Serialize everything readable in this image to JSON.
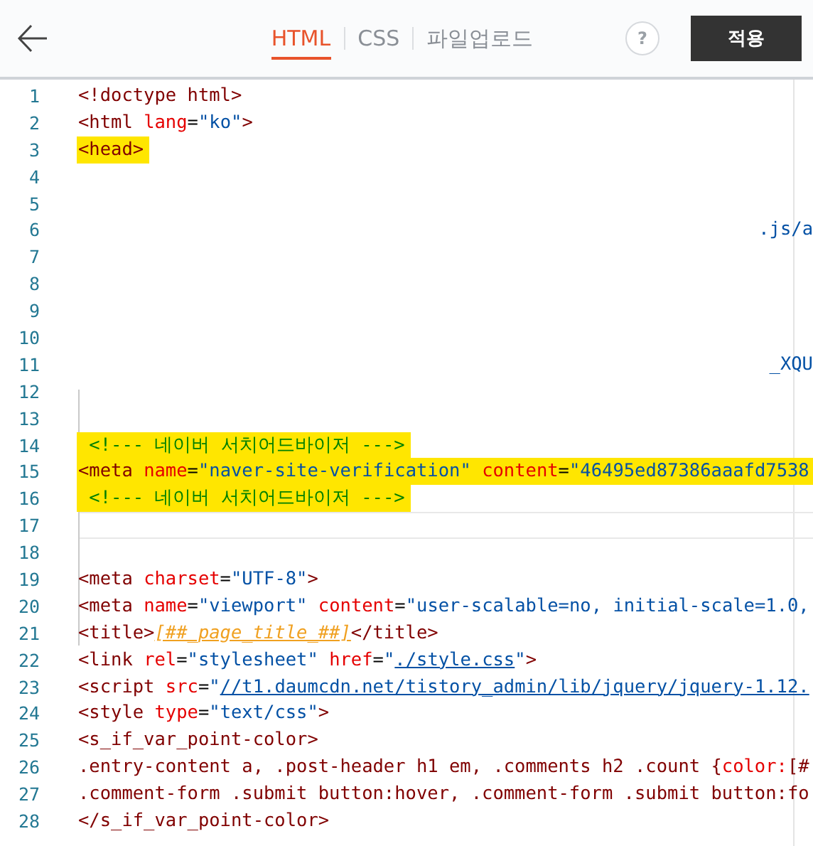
{
  "header": {
    "tabs": [
      {
        "label": "HTML",
        "selected": true
      },
      {
        "label": "CSS",
        "selected": false
      },
      {
        "label": "파일업로드",
        "selected": false
      }
    ],
    "help_button": "?",
    "apply_button": "적용"
  },
  "editor": {
    "lines": [
      {
        "number": "1",
        "highlighted": false,
        "current": false,
        "tokens": [
          {
            "kind": "tag",
            "text": "<!doctype html>"
          }
        ]
      },
      {
        "number": "2",
        "highlighted": false,
        "current": false,
        "tokens": [
          {
            "kind": "tag",
            "text": "<html "
          },
          {
            "kind": "attr",
            "text": "lang"
          },
          {
            "kind": "text",
            "text": "="
          },
          {
            "kind": "string",
            "text": "\"ko\""
          },
          {
            "kind": "tag",
            "text": ">"
          }
        ]
      },
      {
        "number": "3",
        "highlighted": true,
        "current": false,
        "tokens": [
          {
            "kind": "tag",
            "text": "<head>"
          }
        ]
      },
      {
        "number": "4",
        "highlighted": false,
        "current": false
      },
      {
        "number": "5",
        "highlighted": false,
        "current": false
      },
      {
        "number": "6",
        "highlighted": false,
        "current": false,
        "tokens": [
          {
            "kind": "tail",
            "text": ".js/a"
          }
        ]
      },
      {
        "number": "7",
        "highlighted": false,
        "current": false
      },
      {
        "number": "8",
        "highlighted": false,
        "current": false
      },
      {
        "number": "9",
        "highlighted": false,
        "current": false
      },
      {
        "number": "10",
        "highlighted": false,
        "current": false
      },
      {
        "number": "11",
        "highlighted": false,
        "current": false,
        "tokens": [
          {
            "kind": "tail",
            "text": "_XQU"
          }
        ]
      },
      {
        "number": "12",
        "highlighted": false,
        "current": false
      },
      {
        "number": "13",
        "highlighted": false,
        "current": false
      },
      {
        "number": "14",
        "highlighted": true,
        "current": false,
        "tokens": [
          {
            "kind": "comment",
            "text": " <!--- 네이버 서치어드바이저 --->"
          }
        ]
      },
      {
        "number": "15",
        "highlighted": true,
        "current": false,
        "tokens": [
          {
            "kind": "tag",
            "text": "<meta "
          },
          {
            "kind": "attr",
            "text": "name"
          },
          {
            "kind": "text",
            "text": "="
          },
          {
            "kind": "string",
            "text": "\"naver-site-verification\" "
          },
          {
            "kind": "attr",
            "text": "content"
          },
          {
            "kind": "text",
            "text": "="
          },
          {
            "kind": "string",
            "text": "\"46495ed87386aaafd7538"
          }
        ]
      },
      {
        "number": "16",
        "highlighted": true,
        "current": false,
        "tokens": [
          {
            "kind": "comment",
            "text": " <!--- 네이버 서치어드바이저 --->"
          }
        ]
      },
      {
        "number": "17",
        "highlighted": false,
        "current": true
      },
      {
        "number": "18",
        "highlighted": false,
        "current": false
      },
      {
        "number": "19",
        "highlighted": false,
        "current": false,
        "tokens": [
          {
            "kind": "tag",
            "text": "<meta "
          },
          {
            "kind": "attr",
            "text": "charset"
          },
          {
            "kind": "text",
            "text": "="
          },
          {
            "kind": "string",
            "text": "\"UTF-8\""
          },
          {
            "kind": "tag",
            "text": ">"
          }
        ]
      },
      {
        "number": "20",
        "highlighted": false,
        "current": false,
        "tokens": [
          {
            "kind": "tag",
            "text": "<meta "
          },
          {
            "kind": "attr",
            "text": "name"
          },
          {
            "kind": "text",
            "text": "="
          },
          {
            "kind": "string",
            "text": "\"viewport\" "
          },
          {
            "kind": "attr",
            "text": "content"
          },
          {
            "kind": "text",
            "text": "="
          },
          {
            "kind": "string",
            "text": "\"user-scalable=no, initial-scale=1.0,"
          }
        ]
      },
      {
        "number": "21",
        "highlighted": false,
        "current": false,
        "tokens": [
          {
            "kind": "tag",
            "text": "<title>"
          },
          {
            "kind": "template",
            "text": "[##_page_title_##]"
          },
          {
            "kind": "tag",
            "text": "</title>"
          }
        ]
      },
      {
        "number": "22",
        "highlighted": false,
        "current": false,
        "tokens": [
          {
            "kind": "tag",
            "text": "<link "
          },
          {
            "kind": "attr",
            "text": "rel"
          },
          {
            "kind": "text",
            "text": "="
          },
          {
            "kind": "string",
            "text": "\"stylesheet\" "
          },
          {
            "kind": "attr",
            "text": "href"
          },
          {
            "kind": "text",
            "text": "="
          },
          {
            "kind": "string",
            "text": "\""
          },
          {
            "kind": "link",
            "text": "./style.css"
          },
          {
            "kind": "string",
            "text": "\""
          },
          {
            "kind": "tag",
            "text": ">"
          }
        ]
      },
      {
        "number": "23",
        "highlighted": false,
        "current": false,
        "tokens": [
          {
            "kind": "tag",
            "text": "<script "
          },
          {
            "kind": "attr",
            "text": "src"
          },
          {
            "kind": "text",
            "text": "="
          },
          {
            "kind": "string",
            "text": "\""
          },
          {
            "kind": "link",
            "text": "//t1.daumcdn.net/tistory_admin/lib/jquery/jquery-1.12."
          }
        ]
      },
      {
        "number": "24",
        "highlighted": false,
        "current": false,
        "tokens": [
          {
            "kind": "tag",
            "text": "<style "
          },
          {
            "kind": "attr",
            "text": "type"
          },
          {
            "kind": "text",
            "text": "="
          },
          {
            "kind": "string",
            "text": "\"text/css\""
          },
          {
            "kind": "tag",
            "text": ">"
          }
        ]
      },
      {
        "number": "25",
        "highlighted": false,
        "current": false,
        "tokens": [
          {
            "kind": "tag",
            "text": "<s_if_var_point-color>"
          }
        ]
      },
      {
        "number": "26",
        "highlighted": false,
        "current": false,
        "tokens": [
          {
            "kind": "css",
            "text": ".entry-content a, .post-header h1 em, .comments h2 .count {"
          },
          {
            "kind": "attr",
            "text": "color:"
          },
          {
            "kind": "css",
            "text": "[#"
          }
        ]
      },
      {
        "number": "27",
        "highlighted": false,
        "current": false,
        "tokens": [
          {
            "kind": "css",
            "text": ".comment-form .submit button:hover, .comment-form .submit button:fo"
          }
        ]
      },
      {
        "number": "28",
        "highlighted": false,
        "current": false,
        "tokens": [
          {
            "kind": "tag",
            "text": "</s_if_var_point-color>"
          }
        ]
      }
    ]
  }
}
